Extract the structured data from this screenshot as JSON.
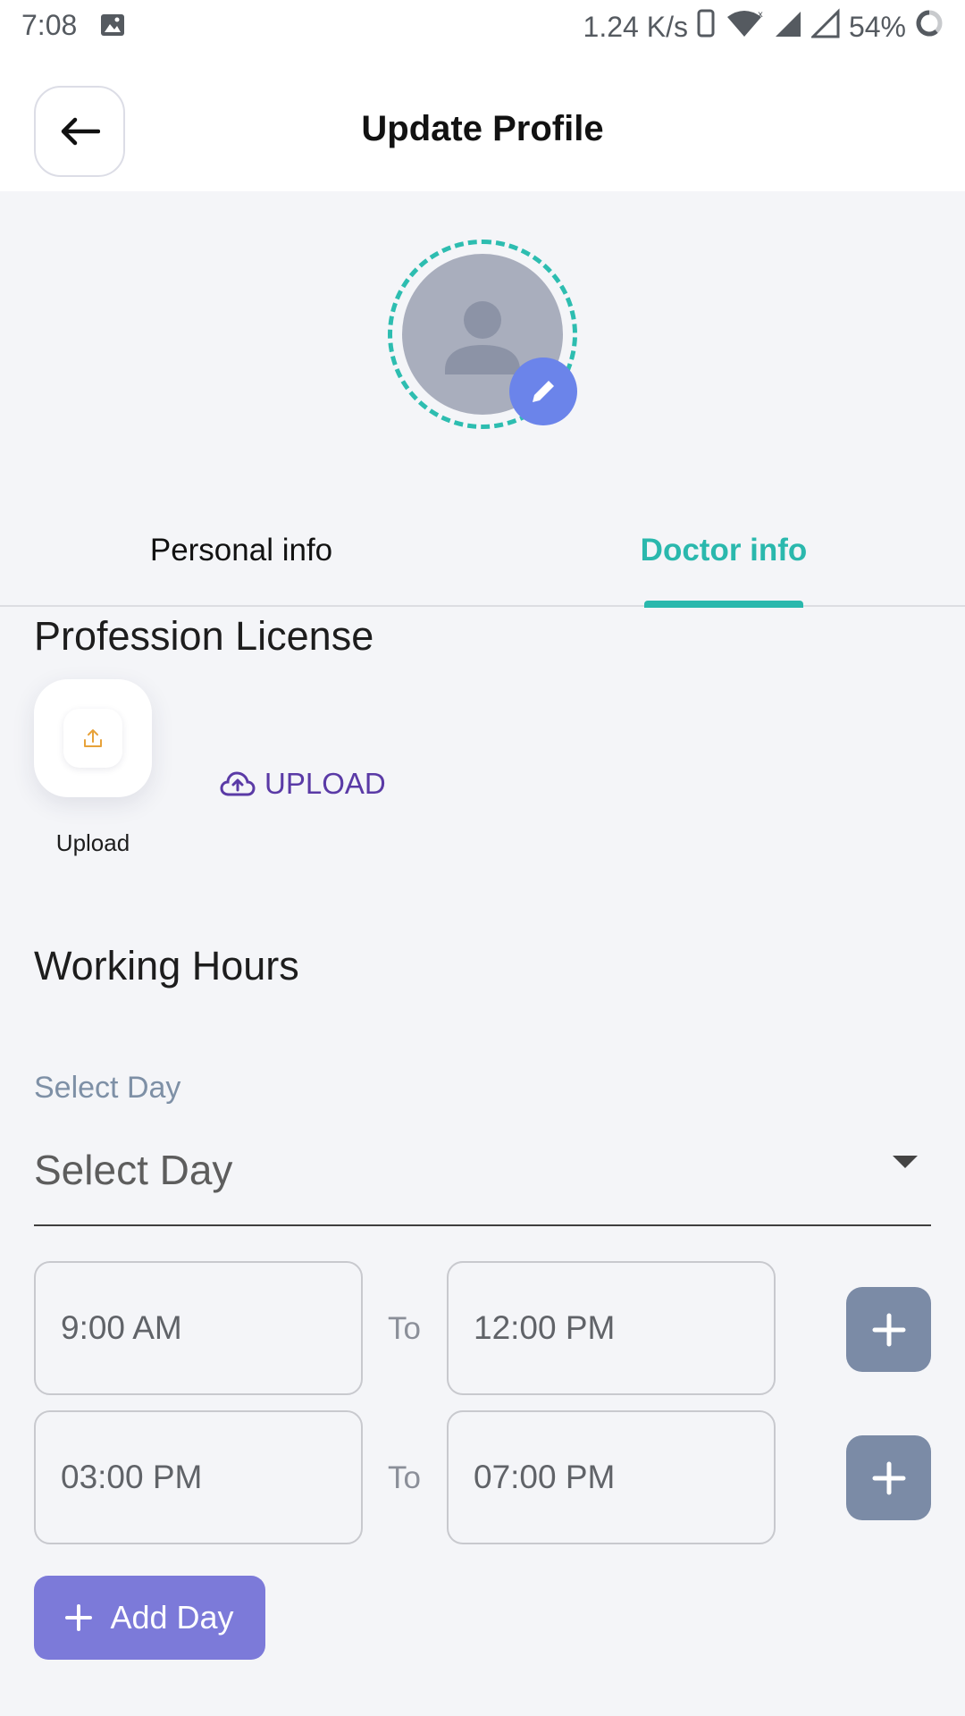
{
  "status_bar": {
    "time": "7:08",
    "speed": "1.24 K/s",
    "battery": "54%"
  },
  "header": {
    "title": "Update Profile"
  },
  "tabs": [
    {
      "label": "Personal info",
      "active": false
    },
    {
      "label": "Doctor info",
      "active": true
    }
  ],
  "license": {
    "title": "Profession License",
    "card_label": "Upload",
    "upload_link": "UPLOAD"
  },
  "working_hours": {
    "title": "Working Hours",
    "select_label": "Select Day",
    "select_value": "Select Day",
    "slots": [
      {
        "from": "9:00 AM",
        "to_label": "To",
        "to": "12:00 PM"
      },
      {
        "from": "03:00 PM",
        "to_label": "To",
        "to": "07:00 PM"
      }
    ],
    "add_day_label": "Add Day"
  },
  "colors": {
    "accent_teal": "#2ab8ad",
    "edit_blue": "#6b84ea",
    "upload_purple": "#5a3aa6",
    "add_day_bg": "#7c7ad9",
    "plus_bg": "#7b8ba6"
  }
}
